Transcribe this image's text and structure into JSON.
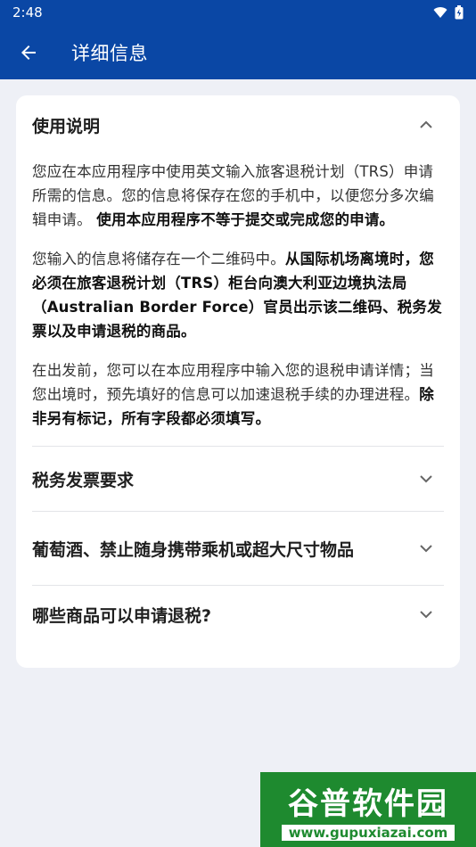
{
  "status_bar": {
    "time": "2:48"
  },
  "app_bar": {
    "title": "详细信息"
  },
  "instructions": {
    "title": "使用说明",
    "p1_a": "您应在本应用程序中使用英文输入旅客退税计划（TRS）申请所需的信息。您的信息将保存在您的手机中，以便您分多次编辑申请。 ",
    "p1_b": "使用本应用程序不等于提交或完成您的申请。",
    "p2_a": "您输入的信息将储存在一个二维码中。",
    "p2_b": "从国际机场离境时，您必须在旅客退税计划（TRS）柜台向澳大利亚边境执法局（Australian Border Force）官员出示该二维码、税务发票以及申请退税的商品。",
    "p3_a": "在出发前，您可以在本应用程序中输入您的退税申请详情；当您出境时，预先填好的信息可以加速退税手续的办理进程。",
    "p3_b": "除非另有标记，所有字段都必须填写。"
  },
  "sections": [
    {
      "title": "税务发票要求"
    },
    {
      "title": "葡萄酒、禁止随身携带乘机或超大尺寸物品"
    },
    {
      "title": "哪些商品可以申请退税?"
    }
  ],
  "watermark": {
    "logo": "谷普软件园",
    "url": "www.gupuxiazai.com"
  }
}
